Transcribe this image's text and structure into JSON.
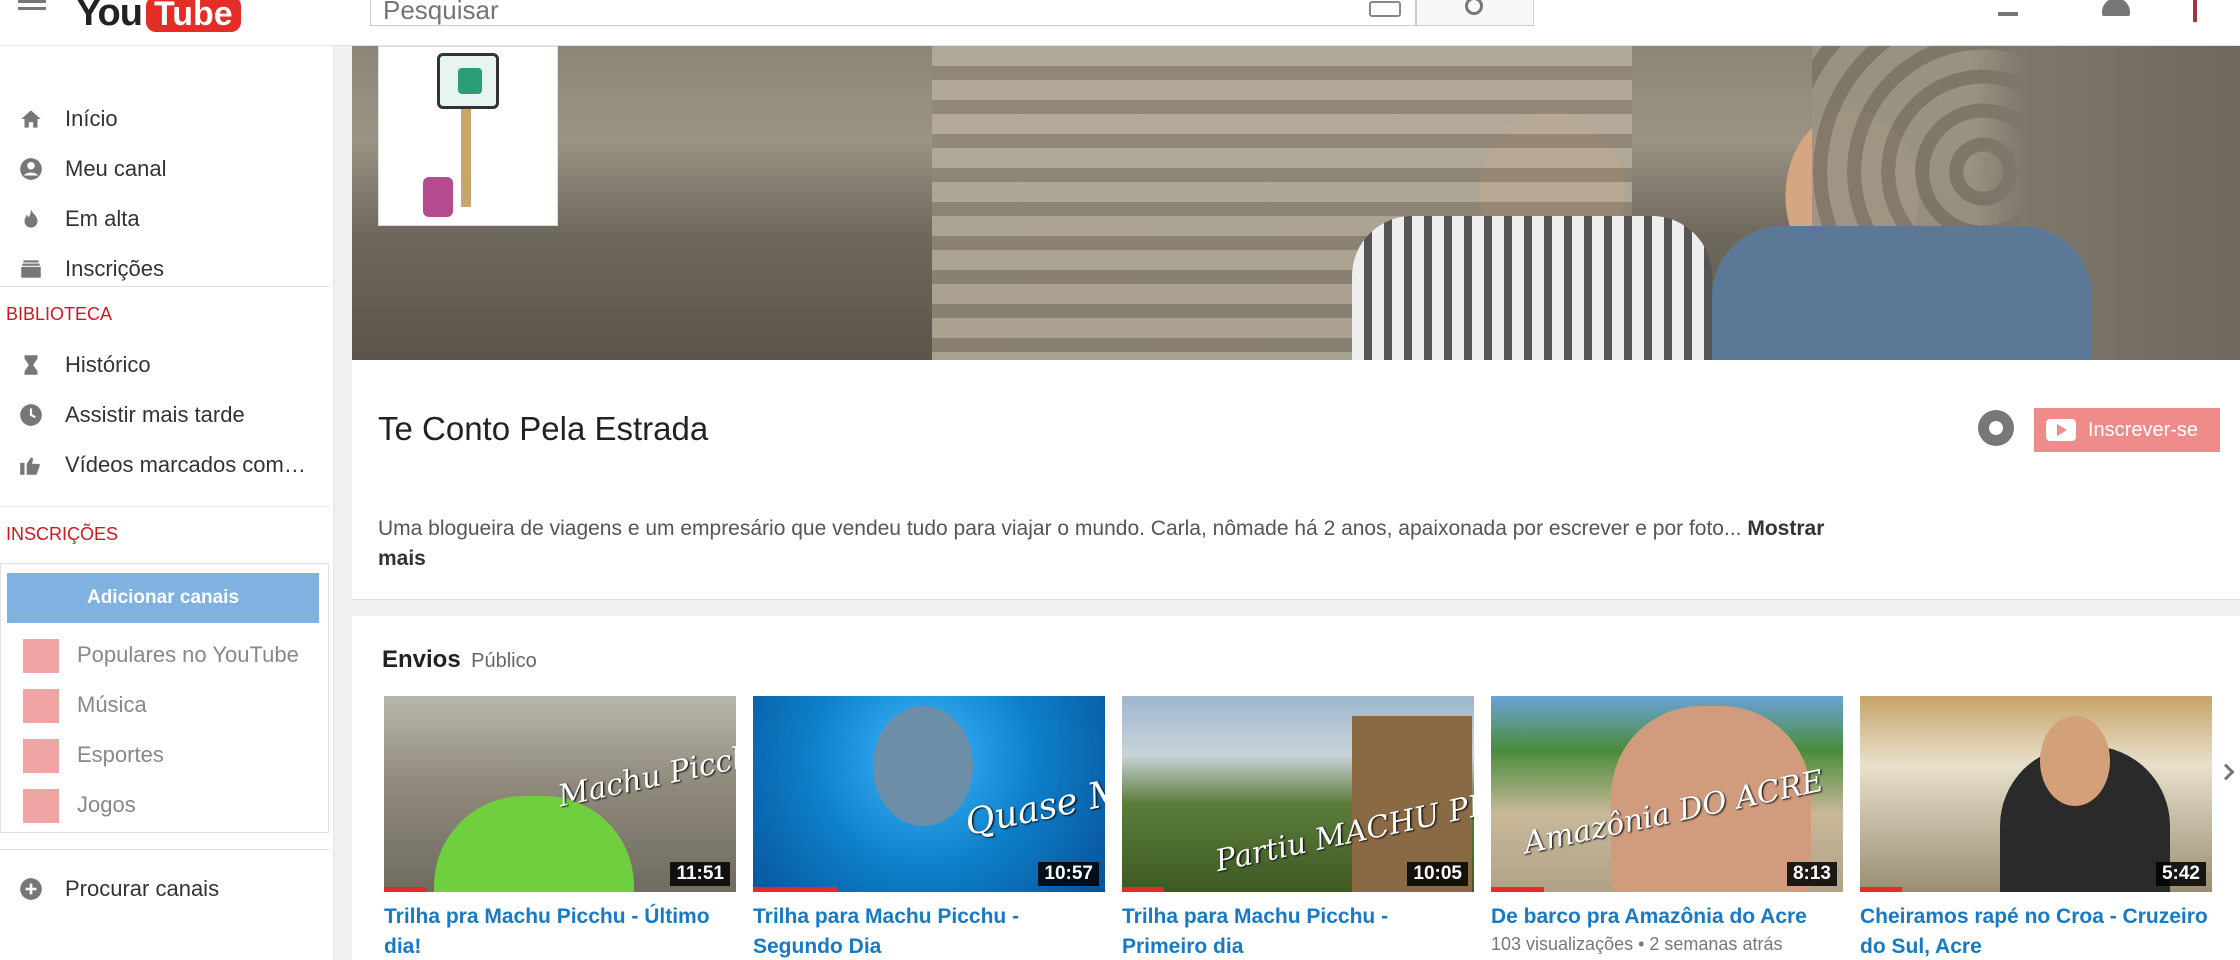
{
  "header": {
    "logo_you": "You",
    "logo_tube": "Tube",
    "search_placeholder": "Pesquisar"
  },
  "sidebar": {
    "nav": [
      {
        "label": "Início",
        "icon": "home-icon"
      },
      {
        "label": "Meu canal",
        "icon": "account-icon"
      },
      {
        "label": "Em alta",
        "icon": "flame-icon"
      },
      {
        "label": "Inscrições",
        "icon": "subscriptions-icon"
      }
    ],
    "library_heading": "BIBLIOTECA",
    "library": [
      {
        "label": "Histórico",
        "icon": "hourglass-icon"
      },
      {
        "label": "Assistir mais tarde",
        "icon": "clock-icon"
      },
      {
        "label": "Vídeos marcados com…",
        "icon": "thumbs-up-icon"
      }
    ],
    "subs_heading": "INSCRIÇÕES",
    "add_channels": "Adicionar canais",
    "subs": [
      {
        "label": "Populares no YouTube",
        "icon": "star-icon"
      },
      {
        "label": "Música",
        "icon": "music-note-icon"
      },
      {
        "label": "Esportes",
        "icon": "ball-icon"
      },
      {
        "label": "Jogos",
        "icon": "gamepad-icon"
      }
    ],
    "browse_channels": "Procurar canais"
  },
  "channel": {
    "title": "Te Conto Pela Estrada",
    "subscribe_label": "Inscrever-se",
    "description": "Uma blogueira de viagens e um empresário que vendeu tudo para viajar o mundo. Carla, nômade há 2 anos, apaixonada por escrever e por foto...",
    "show_more": "Mostrar mais"
  },
  "uploads": {
    "title": "Envios",
    "visibility": "Público",
    "videos": [
      {
        "title": "Trilha pra Machu Picchu - Último dia!",
        "meta": "",
        "duration": "11:51",
        "overlay_text": "Machu Picchu CHEGAMOS!",
        "progress": 0.12
      },
      {
        "title": "Trilha para Machu Picchu - Segundo Dia",
        "meta": "",
        "duration": "10:57",
        "overlay_text": "Quase MORRI!",
        "progress": 0.24
      },
      {
        "title": "Trilha para Machu Picchu - Primeiro dia",
        "meta": "",
        "duration": "10:05",
        "overlay_text": "Partiu MACHU PICCHU!",
        "progress": 0.12
      },
      {
        "title": "De barco pra Amazônia do Acre",
        "meta": "103 visualizações • 2 semanas atrás",
        "duration": "8:13",
        "overlay_text": "Amazônia DO ACRE",
        "progress": 0.15
      },
      {
        "title": "Cheiramos rapé no Croa - Cruzeiro do Sul, Acre",
        "meta": "",
        "duration": "5:42",
        "overlay_text": "",
        "progress": 0.12
      }
    ]
  },
  "colors": {
    "accent_red": "#e52d27",
    "link_blue": "#167ac6",
    "subscribe_bg": "#f08b8b",
    "add_channels_bg": "#7fb2e0"
  }
}
